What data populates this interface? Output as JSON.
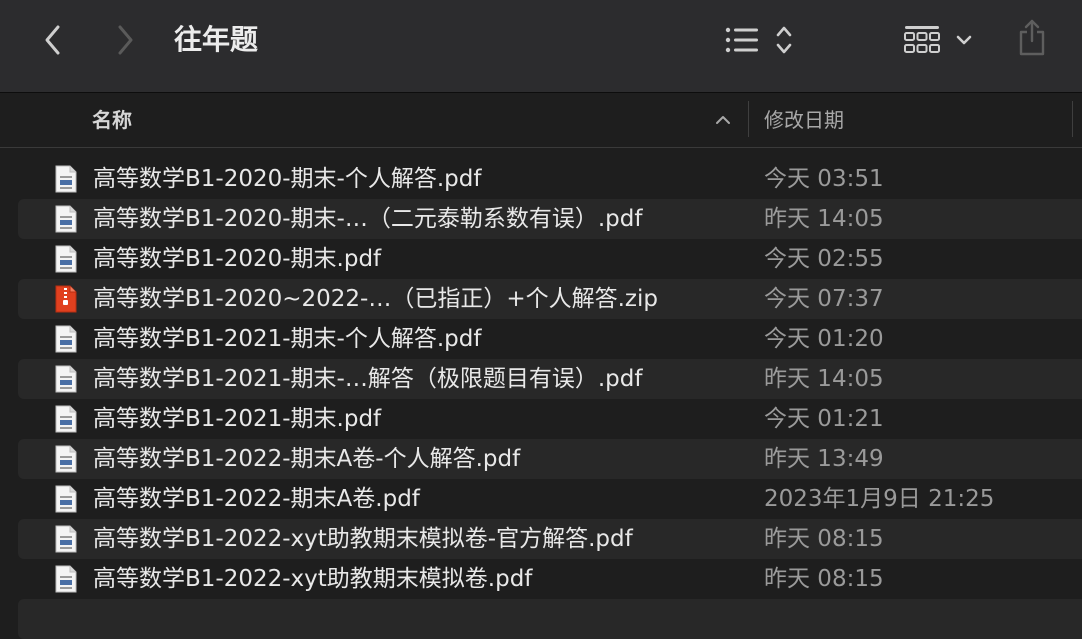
{
  "window": {
    "title": "往年题"
  },
  "columns": {
    "name": "名称",
    "date": "修改日期"
  },
  "files": [
    {
      "name": "高等数学B1-2020-期末-个人解答.pdf",
      "date": "今天 03:51",
      "type": "pdf"
    },
    {
      "name": "高等数学B1-2020-期末-…（二元泰勒系数有误）.pdf",
      "date": "昨天 14:05",
      "type": "pdf"
    },
    {
      "name": "高等数学B1-2020-期末.pdf",
      "date": "今天 02:55",
      "type": "pdf"
    },
    {
      "name": "高等数学B1-2020~2022-…（已指正）+个人解答.zip",
      "date": "今天 07:37",
      "type": "zip"
    },
    {
      "name": "高等数学B1-2021-期末-个人解答.pdf",
      "date": "今天 01:20",
      "type": "pdf"
    },
    {
      "name": "高等数学B1-2021-期末-…解答（极限题目有误）.pdf",
      "date": "昨天 14:05",
      "type": "pdf"
    },
    {
      "name": "高等数学B1-2021-期末.pdf",
      "date": "今天 01:21",
      "type": "pdf"
    },
    {
      "name": "高等数学B1-2022-期末A卷-个人解答.pdf",
      "date": "昨天 13:49",
      "type": "pdf"
    },
    {
      "name": "高等数学B1-2022-期末A卷.pdf",
      "date": "2023年1月9日 21:25",
      "type": "pdf"
    },
    {
      "name": "高等数学B1-2022-xyt助教期末模拟卷-官方解答.pdf",
      "date": "昨天 08:15",
      "type": "pdf"
    },
    {
      "name": "高等数学B1-2022-xyt助教期末模拟卷.pdf",
      "date": "昨天 08:15",
      "type": "pdf"
    }
  ],
  "icons": {
    "back": "chevron-left-icon",
    "forward": "chevron-right-icon",
    "list_view": "list-view-icon",
    "sort": "sort-updown-icon",
    "group": "icon-grid-icon",
    "group_menu": "chevron-down-icon",
    "share": "share-icon",
    "pdf": "pdf-file-icon",
    "zip": "zip-archive-icon"
  },
  "colors": {
    "toolbar_bg": "#2c2c2e",
    "window_bg": "#1e1e1e",
    "row_alt": "#282828",
    "zip_accent": "#e0401f"
  }
}
